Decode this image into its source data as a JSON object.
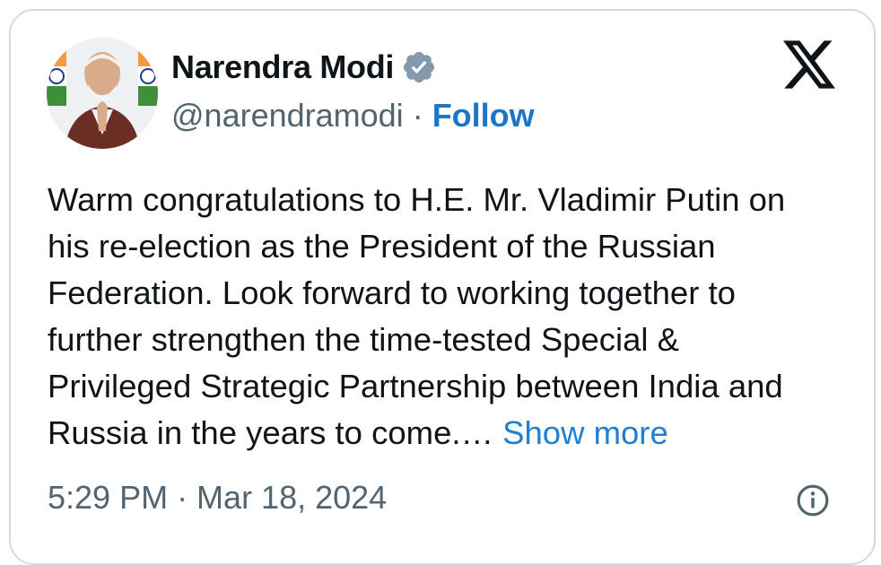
{
  "author": {
    "display_name": "Narendra Modi",
    "handle": "@narendramodi",
    "verified": true,
    "verified_color": "#829aab",
    "follow_label": "Follow",
    "separator": "·"
  },
  "platform_icon": "x-logo-icon",
  "tweet": {
    "lines": [
      "Warm congratulations to H.E. Mr. Vladimir Putin on",
      "his re-election as the President of the Russian",
      "Federation. Look forward to working together to",
      "further strengthen the time-tested Special &",
      "Privileged Strategic Partnership between India and",
      "Russia in the years to come.… "
    ],
    "show_more_label": "Show more"
  },
  "meta": {
    "timestamp": "5:29 PM · Mar 18, 2024"
  },
  "colors": {
    "text": "#0f1419",
    "secondary": "#536471",
    "link": "#1d75c8",
    "border": "#d4dadf"
  }
}
